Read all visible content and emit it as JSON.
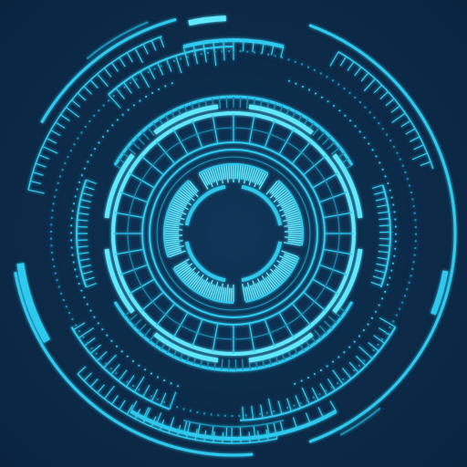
{
  "colors": {
    "background": "#0c2a48",
    "primary": "#2ec9ee",
    "bright": "#5ee8ff",
    "dim": "#1b8fb5"
  },
  "graphic": "circular-hud-interface"
}
